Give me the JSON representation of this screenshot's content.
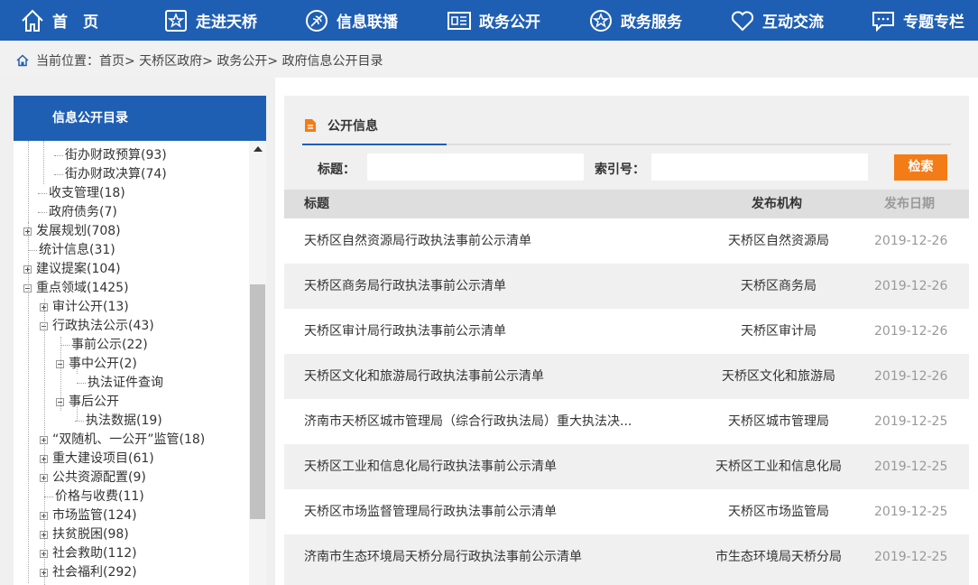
{
  "nav": {
    "items": [
      {
        "label": "首　页",
        "icon": "home-icon"
      },
      {
        "label": "走进天桥",
        "icon": "star-square-icon"
      },
      {
        "label": "信息联播",
        "icon": "broadcast-icon"
      },
      {
        "label": "政务公开",
        "icon": "document-board-icon"
      },
      {
        "label": "政务服务",
        "icon": "star-circle-icon"
      },
      {
        "label": "互动交流",
        "icon": "heart-icon"
      },
      {
        "label": "专题专栏",
        "icon": "chat-icon"
      }
    ]
  },
  "breadcrumb": {
    "text": "当前位置：首页> 天桥区政府> 政务公开> 政府信息公开目录"
  },
  "sidebar": {
    "title": "信息公开目录",
    "items": [
      {
        "label": "街办财政预算(93)"
      },
      {
        "label": "街办财政决算(74)"
      },
      {
        "label": "收支管理(18)"
      },
      {
        "label": "政府债务(7)"
      },
      {
        "label": "发展规划(708)"
      },
      {
        "label": "统计信息(31)"
      },
      {
        "label": "建议提案(104)"
      },
      {
        "label": "重点领域(1425)"
      },
      {
        "label": "审计公开(13)"
      },
      {
        "label": "行政执法公示(43)"
      },
      {
        "label": "事前公示(22)"
      },
      {
        "label": "事中公开(2)"
      },
      {
        "label": "执法证件查询"
      },
      {
        "label": "事后公开"
      },
      {
        "label": "执法数据(19)"
      },
      {
        "label": "“双随机、一公开”监管(18)"
      },
      {
        "label": "重大建设项目(61)"
      },
      {
        "label": "公共资源配置(9)"
      },
      {
        "label": "价格与收费(11)"
      },
      {
        "label": "市场监管(124)"
      },
      {
        "label": "扶贫脱困(98)"
      },
      {
        "label": "社会救助(112)"
      },
      {
        "label": "社会福利(292)"
      }
    ]
  },
  "content": {
    "tab": "公开信息",
    "search": {
      "title_label": "标题：",
      "index_label": "索引号：",
      "button": "检索",
      "title_value": "",
      "index_value": ""
    },
    "table": {
      "headers": [
        "标题",
        "发布机构",
        "发布日期"
      ],
      "rows": [
        {
          "title": "天桥区自然资源局行政执法事前公示清单",
          "org": "天桥区自然资源局",
          "date": "2019-12-26"
        },
        {
          "title": "天桥区商务局行政执法事前公示清单",
          "org": "天桥区商务局",
          "date": "2019-12-26"
        },
        {
          "title": "天桥区审计局行政执法事前公示清单",
          "org": "天桥区审计局",
          "date": "2019-12-26"
        },
        {
          "title": "天桥区文化和旅游局行政执法事前公示清单",
          "org": "天桥区文化和旅游局",
          "date": "2019-12-26"
        },
        {
          "title": "济南市天桥区城市管理局（综合行政执法局）重大执法决...",
          "org": "天桥区城市管理局",
          "date": "2019-12-25"
        },
        {
          "title": "天桥区工业和信息化局行政执法事前公示清单",
          "org": "天桥区工业和信息化局",
          "date": "2019-12-25"
        },
        {
          "title": "天桥区市场监督管理局行政执法事前公示清单",
          "org": "天桥区市场监管局",
          "date": "2019-12-25"
        },
        {
          "title": "济南市生态环境局天桥分局行政执法事前公示清单",
          "org": "市生态环境局天桥分局",
          "date": "2019-12-25"
        }
      ]
    }
  }
}
